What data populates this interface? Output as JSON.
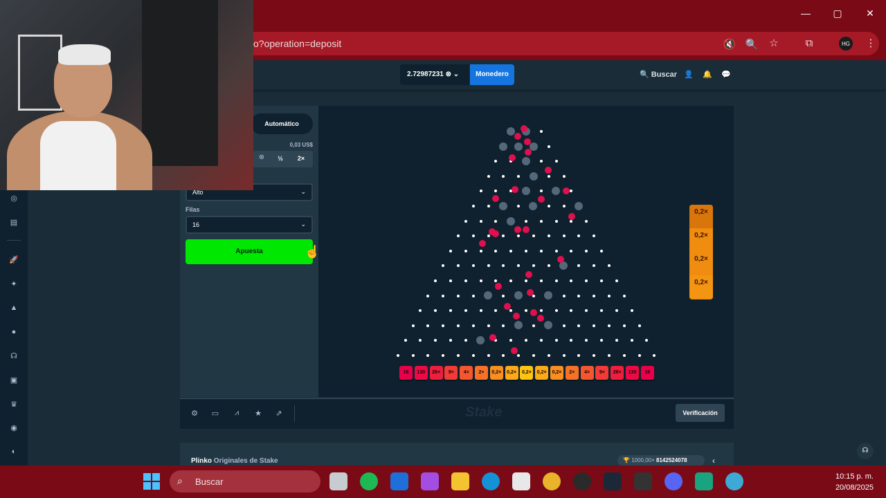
{
  "browser": {
    "url": "o?operation=deposit",
    "controls": {
      "minimize": "—",
      "maximize": "▢",
      "close": "✕"
    }
  },
  "header": {
    "balance": "2.72987231",
    "wallet_label": "Monedero",
    "search_label": "Buscar"
  },
  "controls": {
    "auto_tab": "Automático",
    "bet_amount_usd": "0,03 US$",
    "half_label": "½",
    "double_label": "2×",
    "risk_value": "Alto",
    "rows_label": "Filas",
    "rows_value": "16",
    "bet_button": "Apuesta"
  },
  "board": {
    "multipliers": [
      "16",
      "130",
      "26×",
      "9×",
      "4×",
      "2×",
      "0,2×",
      "0,2×",
      "0,2×",
      "0,2×",
      "0,2×",
      "2×",
      "4×",
      "9×",
      "26×",
      "130",
      "16"
    ],
    "multiplier_colors": [
      "#e8004a",
      "#ec0a45",
      "#ef1d3e",
      "#f23a36",
      "#f4562e",
      "#f77226",
      "#f98f1f",
      "#fbab18",
      "#fdc511",
      "#fbab18",
      "#f98f1f",
      "#f77226",
      "#f4562e",
      "#f23a36",
      "#ef1d3e",
      "#ec0a45",
      "#e8004a"
    ],
    "history": [
      "0,2×",
      "0,2×",
      "0,2×",
      "0,2×"
    ]
  },
  "footer": {
    "verification_label": "Verificación",
    "watermark": "Stake"
  },
  "info": {
    "game_title": "Plinko",
    "game_subtitle": "Originales de Stake",
    "jackpot": "1000,00×",
    "jackpot_id": "8142524078"
  },
  "taskbar": {
    "search_label": "Buscar",
    "time": "10:15 p. m.",
    "date": "20/08/2025"
  }
}
